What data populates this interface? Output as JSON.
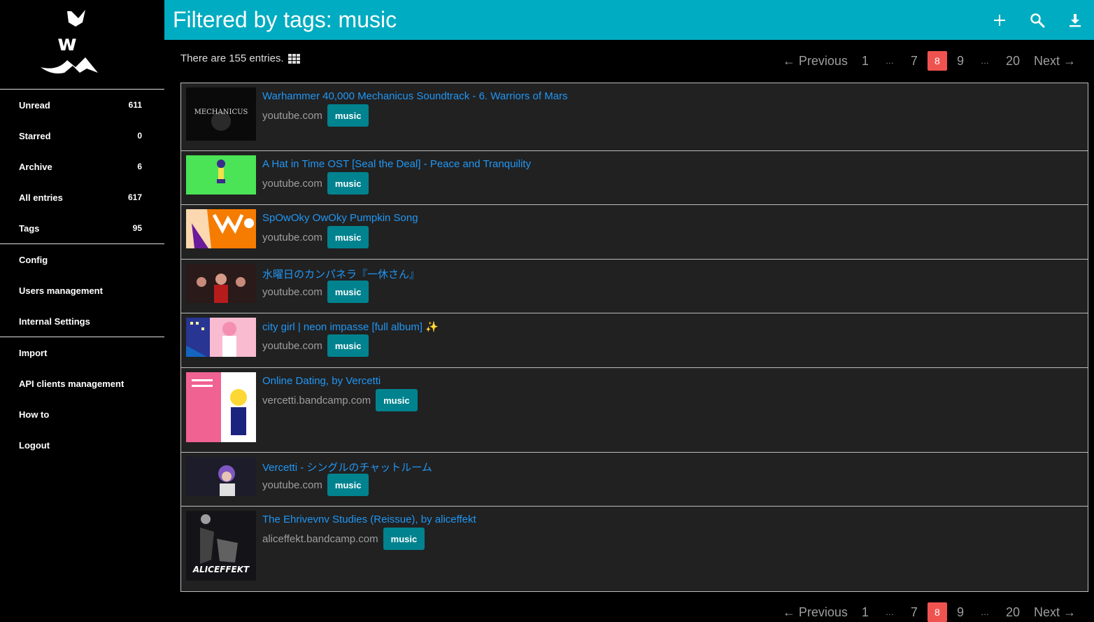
{
  "sidebar": {
    "logo_alt": "wallabag logo",
    "items": [
      {
        "label": "Unread",
        "count": "611"
      },
      {
        "label": "Starred",
        "count": "0"
      },
      {
        "label": "Archive",
        "count": "6"
      },
      {
        "label": "All entries",
        "count": "617"
      },
      {
        "label": "Tags",
        "count": "95"
      },
      {
        "label": "Config",
        "count": ""
      },
      {
        "label": "Users management",
        "count": ""
      },
      {
        "label": "Internal Settings",
        "count": ""
      },
      {
        "label": "Import",
        "count": ""
      },
      {
        "label": "API clients management",
        "count": ""
      },
      {
        "label": "How to",
        "count": ""
      },
      {
        "label": "Logout",
        "count": ""
      }
    ]
  },
  "header": {
    "title": "Filtered by tags: music",
    "icons": [
      "add-icon",
      "search-icon",
      "download-icon"
    ],
    "color": "#00acc1"
  },
  "summary": {
    "text": "There are 155 entries."
  },
  "pagination": {
    "previous": "← Previous",
    "next": "Next →",
    "pages": [
      "1",
      "…",
      "7",
      "8",
      "9",
      "…",
      "20"
    ],
    "current": "8"
  },
  "entries": [
    {
      "title": "Warhammer 40,000 Mechanicus Soundtrack - 6. Warriors of Mars",
      "domain": "youtube.com",
      "tag": "music"
    },
    {
      "title": "A Hat in Time OST [Seal the Deal] - Peace and Tranquility",
      "domain": "youtube.com",
      "tag": "music"
    },
    {
      "title": "SpOwOky OwOky Pumpkin Song",
      "domain": "youtube.com",
      "tag": "music"
    },
    {
      "title": "水曜日のカンパネラ『一休さん』",
      "domain": "youtube.com",
      "tag": "music"
    },
    {
      "title": "city girl | neon impasse [full album] ✨",
      "domain": "youtube.com",
      "tag": "music"
    },
    {
      "title": "Online Dating, by Vercetti",
      "domain": "vercetti.bandcamp.com",
      "tag": "music"
    },
    {
      "title": "Vercetti - シングルのチャットルーム",
      "domain": "youtube.com",
      "tag": "music"
    },
    {
      "title": "The Ehrivevnv Studies (Reissue), by aliceffekt",
      "domain": "aliceffekt.bandcamp.com",
      "tag": "music"
    }
  ],
  "thumbnail_text": {
    "mechanicus": "MECHANICUS",
    "aliceffekt": "ALICEFFEKT"
  },
  "colors": {
    "accent": "#00acc1",
    "tag": "#00838f",
    "link": "#2196f3",
    "current_page": "#ef5350"
  }
}
